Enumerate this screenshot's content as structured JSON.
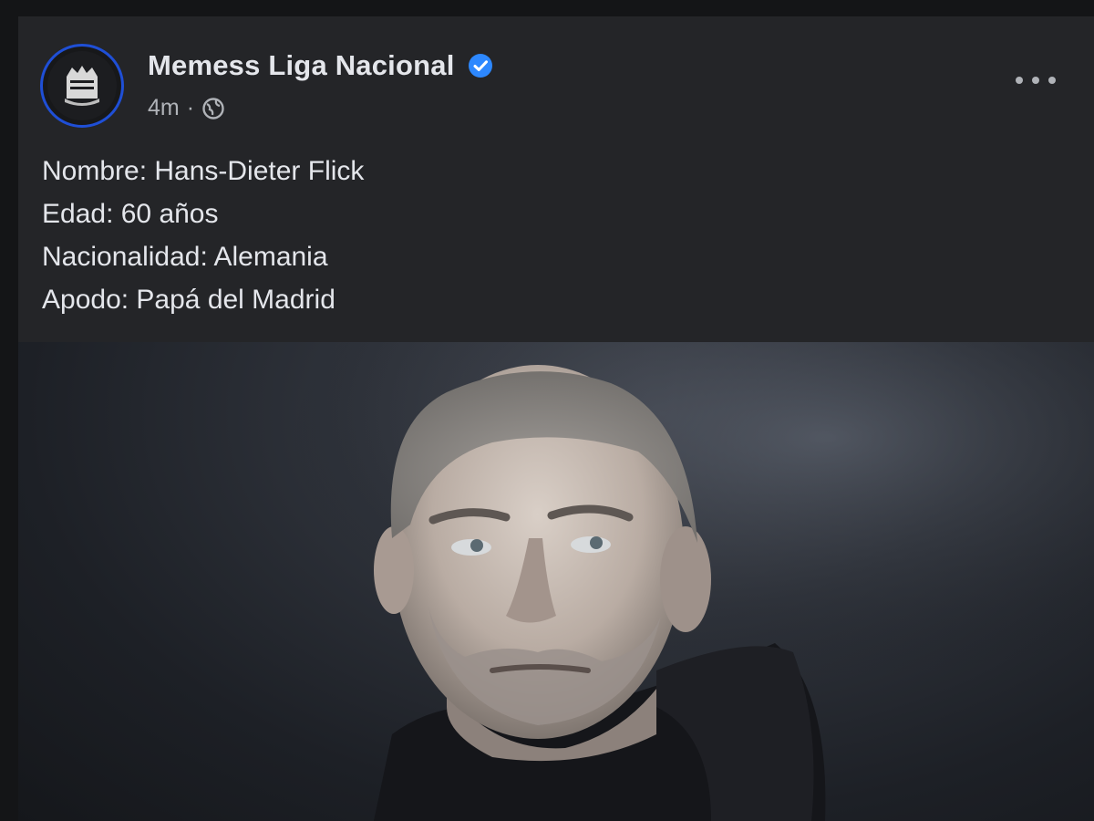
{
  "post": {
    "page_name": "Memess Liga Nacional",
    "verified_icon": "verified-badge-icon",
    "timestamp": "4m",
    "separator": "·",
    "audience_icon": "globe-icon",
    "more_icon": "more-options-icon",
    "avatar_icon": "crest-logo",
    "accent_color": "#1f4fd6",
    "verified_color": "#2d88ff",
    "lines": [
      "Nombre: Hans-Dieter Flick",
      "Edad: 60 años",
      "Nacionalidad: Alemania",
      "Apodo: Papá del Madrid"
    ],
    "photo_subject": "man-portrait-photo"
  }
}
